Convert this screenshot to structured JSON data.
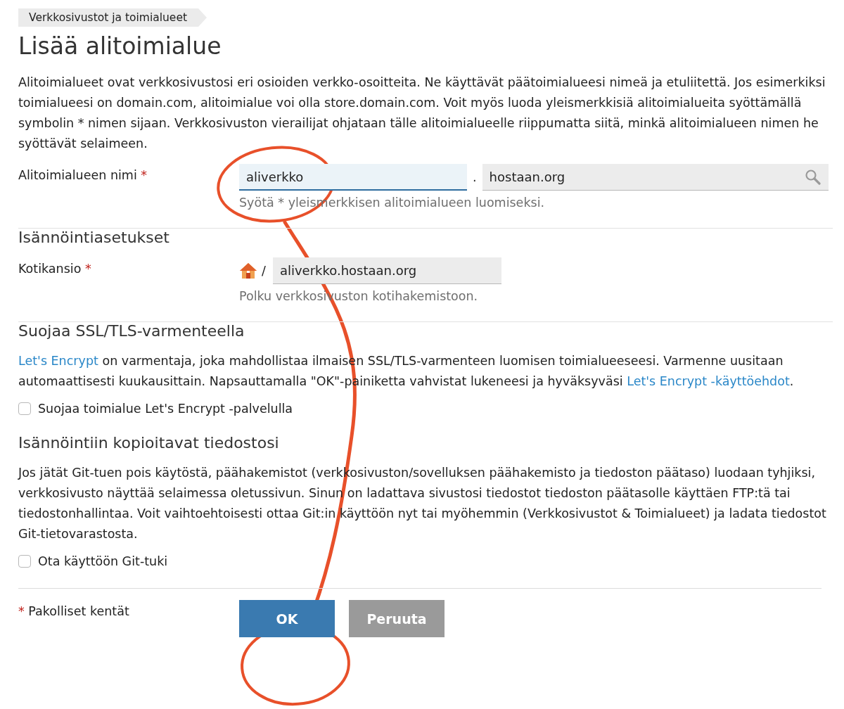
{
  "breadcrumb": "Verkkosivustot ja toimialueet",
  "title": "Lisää alitoimialue",
  "intro": "Alitoimialueet ovat verkkosivustosi eri osioiden verkko-osoitteita. Ne käyttävät päätoimialueesi nimeä ja etuliitettä. Jos esimerkiksi toimialueesi on domain.com, alitoimialue voi olla store.domain.com. Voit myös luoda yleismerkkisiä alitoimialueita syöttämällä symbolin * nimen sijaan. Verkkosivuston vierailijat ohjataan tälle alitoimialueelle riippumatta siitä, minkä alitoimialueen nimen he syöttävät selaimeen.",
  "subdomain": {
    "label": "Alitoimialueen nimi",
    "required_mark": "*",
    "value": "aliverkko",
    "focused": true,
    "separator": ".",
    "domain": "hostaan.org",
    "hint": "Syötä * yleismerkkisen alitoimialueen luomiseksi."
  },
  "hosting": {
    "heading": "Isännöintiasetukset",
    "label": "Kotikansio",
    "required_mark": "*",
    "separator": "/",
    "value": "aliverkko.hostaan.org",
    "hint": "Polku verkkosivuston kotihakemistoon."
  },
  "ssl": {
    "heading": "Suojaa SSL/TLS-varmenteella",
    "text": [
      {
        "kind": "link",
        "text": "Let's Encrypt"
      },
      {
        "kind": "text",
        "text": " on varmentaja, joka mahdollistaa ilmaisen SSL/TLS-varmenteen luomisen toimialueeseesi. Varmenne uusitaan automaattisesti kuukausittain. Napsauttamalla \"OK\"-painiketta vahvistat lukeneesi ja hyväksyväsi "
      },
      {
        "kind": "link",
        "text": "Let's Encrypt -käyttöehdot"
      },
      {
        "kind": "text",
        "text": "."
      }
    ],
    "checkbox": {
      "label": "Suojaa toimialue Let's Encrypt -palvelulla",
      "checked": false
    }
  },
  "files": {
    "heading": "Isännöintiin kopioitavat tiedostosi",
    "text": "Jos jätät Git-tuen pois käytöstä, päähakemistot (verkkosivuston/sovelluksen päähakemisto ja tiedoston päätaso) luodaan tyhjiksi, verkkosivusto näyttää selaimessa oletussivun. Sinun on ladattava sivustosi tiedostot tiedoston päätasolle käyttäen FTP:tä tai tiedostonhallintaa. Voit vaihtoehtoisesti ottaa Git:in käyttöön nyt tai myöhemmin (Verkkosivustot & Toimialueet) ja ladata tiedostot Git-tietovarastosta.",
    "checkbox": {
      "label": "Ota käyttöön Git-tuki",
      "checked": false
    }
  },
  "footer": {
    "required_mark": "*",
    "required_note": "Pakolliset kentät",
    "buttons": [
      {
        "label": "OK",
        "kind": "primary"
      },
      {
        "label": "Peruuta",
        "kind": "secondary"
      }
    ]
  }
}
